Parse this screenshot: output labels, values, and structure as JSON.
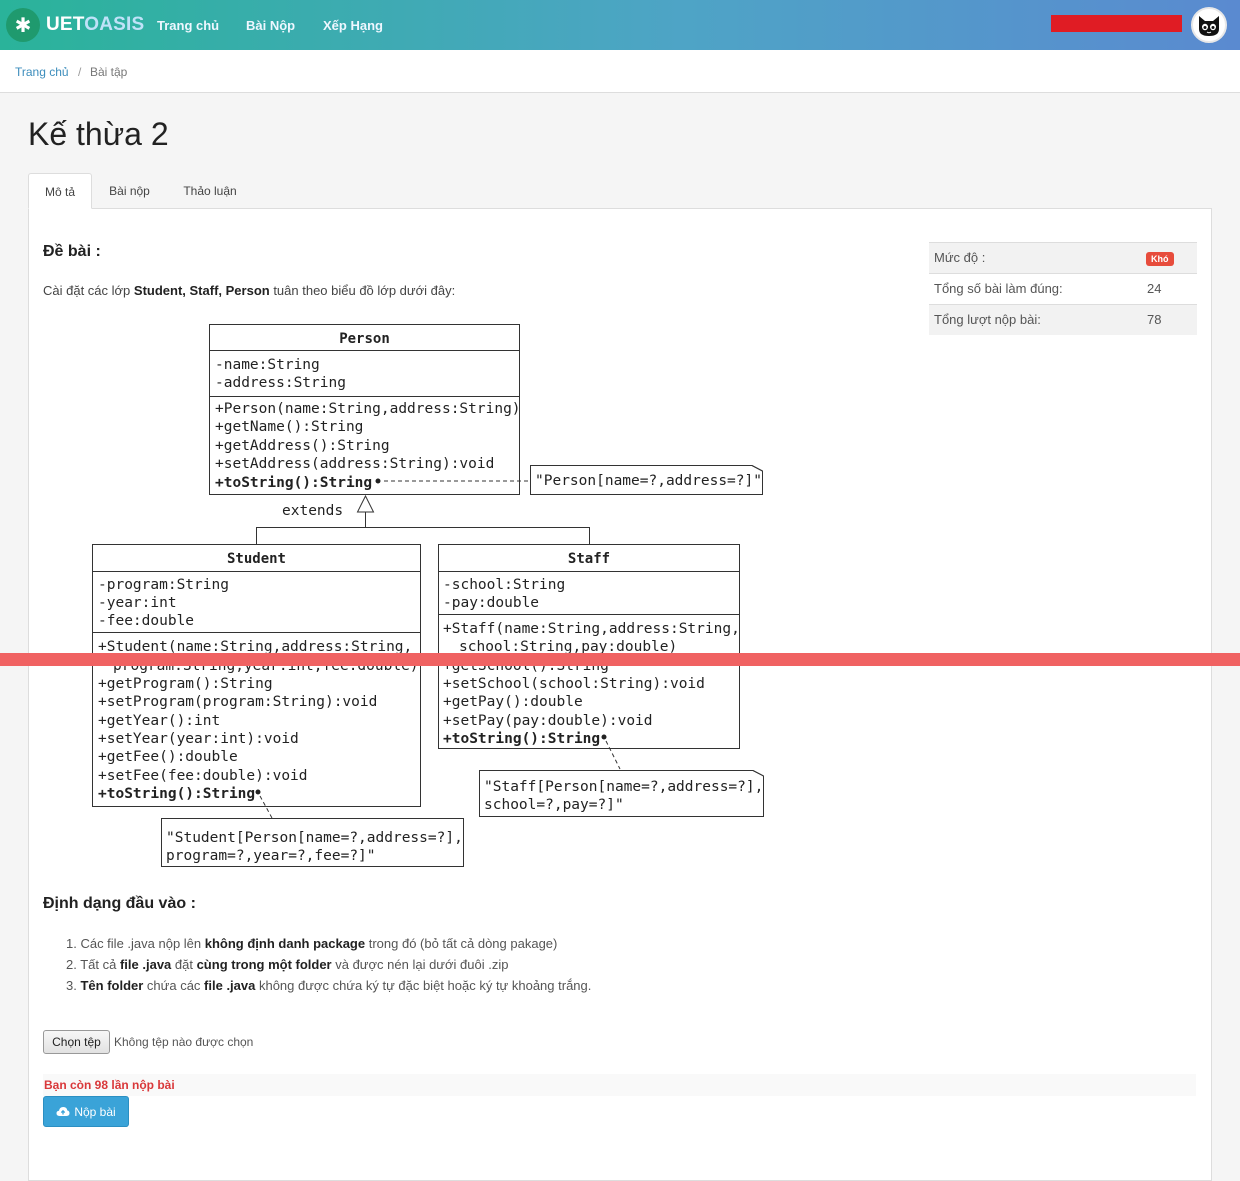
{
  "brand": {
    "part1": "UET",
    "part2": "OASIS"
  },
  "nav": [
    "Trang chủ",
    "Bài Nộp",
    "Xếp Hạng"
  ],
  "breadcrumb": {
    "home": "Trang chủ",
    "sep": "/",
    "current": "Bài tập"
  },
  "page_title": "Kế thừa 2",
  "tabs": [
    "Mô tả",
    "Bài nộp",
    "Thảo luận"
  ],
  "problem": {
    "heading": "Đề bài :",
    "desc_prefix": "Cài đặt các lớp ",
    "desc_bold": "Student, Staff, Person",
    "desc_suffix": " tuân theo biểu đồ lớp dưới đây:"
  },
  "meta": {
    "level_label": "Mức độ :",
    "level_badge": "Khó",
    "correct_label": "Tổng số bài làm đúng:",
    "correct_value": "24",
    "submissions_label": "Tổng lượt nộp bài:",
    "submissions_value": "78"
  },
  "uml": {
    "person_title": "Person",
    "person_attrs": [
      "-name:String",
      "-address:String"
    ],
    "person_methods": [
      "+Person(name:String,address:String)",
      "+getName():String",
      "+getAddress():String",
      "+setAddress(address:String):void"
    ],
    "person_tostring": "+toString():String",
    "person_note": "\"Person[name=?,address=?]\"",
    "extends_label": "extends",
    "student_title": "Student",
    "student_attrs": [
      "-program:String",
      "-year:int",
      "-fee:double"
    ],
    "student_methods": [
      "+Student(name:String,address:String,",
      "program:String,year:int,fee:double)",
      "+getProgram():String",
      "+setProgram(program:String):void",
      "+getYear():int",
      "+setYear(year:int):void",
      "+getFee():double",
      "+setFee(fee:double):void"
    ],
    "student_tostring": "+toString():String",
    "student_note": [
      "\"Student[Person[name=?,address=?],",
      "program=?,year=?,fee=?]\""
    ],
    "staff_title": "Staff",
    "staff_attrs": [
      "-school:String",
      "-pay:double"
    ],
    "staff_methods": [
      "+Staff(name:String,address:String,",
      "school:String,pay:double)",
      "+getSchool():String",
      "+setSchool(school:String):void",
      "+getPay():double",
      "+setPay(pay:double):void"
    ],
    "staff_tostring": "+toString():String",
    "staff_note": [
      "\"Staff[Person[name=?,address=?],",
      "school=?,pay=?]\""
    ]
  },
  "input_format": {
    "heading": "Định dạng đầu vào :",
    "items": [
      {
        "n": "1.",
        "a": " Các file .java nộp lên ",
        "b": "không định danh package",
        "c": " trong đó (bỏ tất cả dòng pakage)"
      },
      {
        "n": "2.",
        "a": " Tất cả ",
        "b": "file .java",
        "c": " đặt ",
        "d": "cùng trong một folder",
        "e": " và được nén lại dưới đuôi .zip"
      },
      {
        "n": "3.",
        "a": " ",
        "b": "Tên folder",
        "c": " chứa các ",
        "d": "file .java",
        "e": " không được chứa ký tự đặc biệt hoặc ký tự khoảng trắng."
      }
    ]
  },
  "upload": {
    "choose_label": "Chọn tệp",
    "no_file": "Không tệp nào được chọn",
    "remaining": "Bạn còn 98 lần nộp bài",
    "submit_label": "Nộp bài"
  }
}
